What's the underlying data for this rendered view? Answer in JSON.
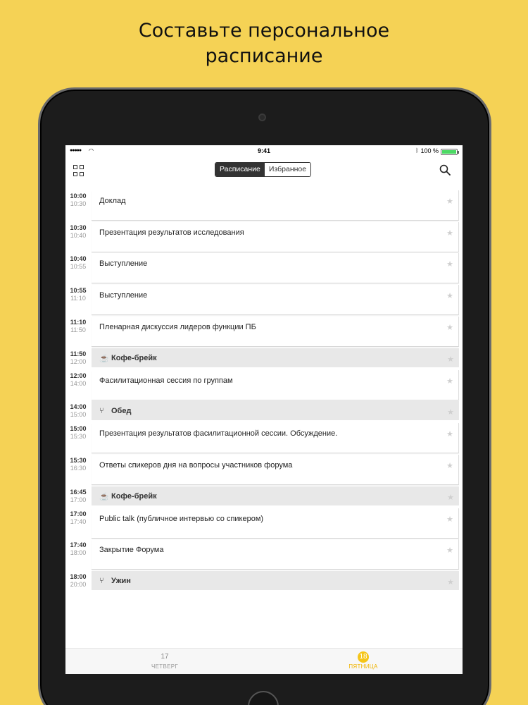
{
  "headline": {
    "line1": "Составьте персональное",
    "line2": "расписание"
  },
  "status_bar": {
    "time": "9:41",
    "battery": "100 %",
    "battery_level": 1.0
  },
  "navbar": {
    "segments": [
      "Расписание",
      "Избранное"
    ],
    "selected_segment": "Расписание",
    "left_icon": "grid-icon",
    "right_icon": "search-icon"
  },
  "schedule": [
    {
      "start": "10:00",
      "end": "10:30",
      "title": "Доклад",
      "type": "session"
    },
    {
      "start": "10:30",
      "end": "10:40",
      "title": "Презентация результатов исследования",
      "type": "session"
    },
    {
      "start": "10:40",
      "end": "10:55",
      "title": "Выступление",
      "type": "session"
    },
    {
      "start": "10:55",
      "end": "11:10",
      "title": "Выступление",
      "type": "session"
    },
    {
      "start": "11:10",
      "end": "11:50",
      "title": "Пленарная дискуссия лидеров функции ПБ",
      "type": "session"
    },
    {
      "start": "11:50",
      "end": "12:00",
      "title": "Кофе-брейк",
      "type": "break",
      "icon": "coffee-icon"
    },
    {
      "start": "12:00",
      "end": "14:00",
      "title": "Фасилитационная сессия по группам",
      "type": "session"
    },
    {
      "start": "14:00",
      "end": "15:00",
      "title": "Обед",
      "type": "break",
      "icon": "fork-knife-icon"
    },
    {
      "start": "15:00",
      "end": "15:30",
      "title": "Презентация результатов фасилитационной сессии. Обсуждение.",
      "type": "session"
    },
    {
      "start": "15:30",
      "end": "16:30",
      "title": "Ответы спикеров дня на вопросы участников форума",
      "type": "session"
    },
    {
      "start": "16:45",
      "end": "17:00",
      "title": "Кофе-брейк",
      "type": "break",
      "icon": "coffee-icon"
    },
    {
      "start": "17:00",
      "end": "17:40",
      "title": "Public talk (публичное интервью со спикером)",
      "type": "session"
    },
    {
      "start": "17:40",
      "end": "18:00",
      "title": "Закрытие Форума",
      "type": "session"
    },
    {
      "start": "18:00",
      "end": "20:00",
      "title": "Ужин",
      "type": "break",
      "icon": "fork-knife-icon"
    }
  ],
  "tabs": [
    {
      "number": "17",
      "label": "ЧЕТВЕРГ",
      "active": false
    },
    {
      "number": "18",
      "label": "ПЯТНИЦА",
      "active": true
    }
  ],
  "colors": {
    "background": "#f5d255",
    "accent": "#f5c518",
    "break_fill": "#e8e8e8"
  }
}
